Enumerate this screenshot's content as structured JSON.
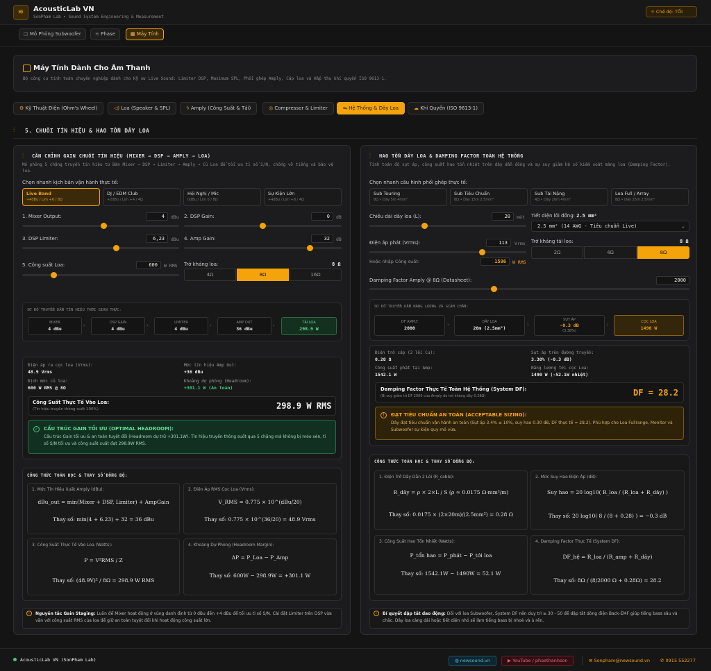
{
  "app": {
    "title": "AcousticLab VN",
    "subtitle": "SonPham Lab • Sound System Engineering & Measurement",
    "theme_label": "Chế độ: TỐI"
  },
  "nav": {
    "tabs": [
      {
        "label": "Mô Phỏng Subwoofer"
      },
      {
        "label": "Phase"
      },
      {
        "label": "Máy Tính"
      }
    ]
  },
  "hero": {
    "title": "Máy Tính Dành Cho Âm Thanh",
    "desc": "Bộ công cụ tính toán chuyên nghiệp dành cho Kỹ sư Live Sound: Limiter DSP, Maximum SPL, Phối ghép Amply, Cáp loa và Hấp thụ khí quyển ISO 9613-1."
  },
  "categories": [
    {
      "label": "Kỹ Thuật Điện (Ohm's Wheel)"
    },
    {
      "label": "Loa (Speaker & SPL)"
    },
    {
      "label": "Amply (Công Suất & Tải)"
    },
    {
      "label": "Compressor & Limiter"
    },
    {
      "label": "Hệ Thống & Dây Loa"
    },
    {
      "label": "Khí Quyển (ISO 9613-1)"
    }
  ],
  "section_title": "5. CHUỖI TÍN HIỆU & HAO TỔN DÂY LOA",
  "left": {
    "title": "CĂN CHỈNH GAIN CHUỖI TÍN HIỆU (MIXER → DSP → AMPLY → LOA)",
    "desc": "Mô phỏng 5 chặng truyền tín hiệu từ Bàn Mixer → DSP → Limiter → Amply → Củ Loa để tối ưu tỉ số S/N, chống vỡ tiếng và bảo vệ loa.",
    "preset_label": "Chọn nhanh kịch bản vận hành thực tế:",
    "presets": [
      {
        "t": "Live Band",
        "s": "+4dBu / Lim +6 / 8Ω"
      },
      {
        "t": "DJ / EDM Club",
        "s": "+2dBu / Lim +4 / 4Ω"
      },
      {
        "t": "Hội Nghị / Mic",
        "s": "0dBu / Lim 0 / 8Ω"
      },
      {
        "t": "Sự Kiện Lớn",
        "s": "+4dBu / Lim +8 / 4Ω"
      }
    ],
    "fields": {
      "mixer": {
        "label": "1. Mixer Output:",
        "value": "4",
        "unit": "dBu",
        "level": 0.52
      },
      "dsp": {
        "label": "2. DSP Gain:",
        "value": "0",
        "unit": "dB",
        "level": 0.5
      },
      "lim": {
        "label": "3. DSP Limiter:",
        "value": "6,23",
        "unit": "dBu",
        "level": 0.6
      },
      "amp": {
        "label": "4. Amp Gain:",
        "value": "32",
        "unit": "dB",
        "level": 0.8
      },
      "pow": {
        "label": "5. Công suất Loa:",
        "value": "600",
        "unit": "W RMS",
        "level": 0.2
      }
    },
    "imp": {
      "label": "Trở kháng loa:",
      "value": "8 Ω",
      "opts": [
        "4Ω",
        "8Ω",
        "16Ω"
      ]
    },
    "flow": {
      "title": "SƠ ĐỒ TRUYỀN DẪN TÍN HIỆU THỜI GIAN THỰC:",
      "nodes": [
        {
          "n": "MIXER",
          "v": "4 dBu"
        },
        {
          "n": "DSP GAIN",
          "v": "4 dBu"
        },
        {
          "n": "LIMITER",
          "v": "4 dBu"
        },
        {
          "n": "AMP OUT",
          "v": "36 dBu"
        },
        {
          "n": "TẢI LOA",
          "v": "298.9 W"
        }
      ]
    },
    "stats": [
      {
        "k": "Điện áp ra cọc loa (Vrms):",
        "v": "48.9 Vrms"
      },
      {
        "k": "Mức tín hiệu Amp Out:",
        "v": "+36 dBu"
      },
      {
        "k": "Định mức củ loa:",
        "v": "600 W RMS @ 8Ω"
      },
      {
        "k": "Khoảng dự phòng (Headroom):",
        "v": "+301.1 W (An toàn)"
      }
    ],
    "real": {
      "title": "Công Suất Thực Tế Vào Loa:",
      "sub": "(Tín hiệu truyền thông suốt 100%)",
      "value": "298.9 W RMS"
    },
    "ok": {
      "title": "CẤU TRÚC GAIN TỐI ƯU (OPTIMAL HEADROOM):",
      "text": "Cấu trúc Gain tối ưu & an toàn tuyệt đối (Headroom dự trữ +301.1W). Tín hiệu truyền thông suốt qua 5 chặng mà không bị méo xén, tỉ số S/N tối ưu và công suất xuất đạt 298.9W RMS."
    },
    "formula_title": "CÔNG THỨC TOÁN HỌC & THAY SỐ ĐỒNG BỘ:",
    "formulas": [
      {
        "h": "1. Mức Tín Hiệu Xuất Amply (dBu):",
        "f": "dBu_out = min(Mixer + DSP, Limiter) + AmpGain",
        "s": "Thay số: min(4 + 6.23) + 32 = 36 dBu"
      },
      {
        "h": "2. Điện Áp RMS Cọc Loa (Vrms):",
        "f": "V_RMS = 0.775 × 10^(dBu/20)",
        "s": "Thay số: 0.775 × 10^(36/20) = 48.9 Vrms"
      },
      {
        "h": "3. Công Suất Thực Tế Vào Loa (Watts):",
        "f": "P = V²RMS / Z",
        "s": "Thay số: (48.9V)² / 8Ω = 298.9 W RMS"
      },
      {
        "h": "4. Khoảng Dự Phòng (Headroom Margin):",
        "f": "ΔP = P_Loa − P_Amp",
        "s": "Thay số: 600W − 298.9W = +301.1 W"
      }
    ],
    "tip": {
      "title": "Nguyên tắc Gain Staging:",
      "text": "Luôn để Mixer hoạt động ở vùng danh định từ 0 dBu đến +4 dBu để tối ưu tỉ số S/N. Cài đặt Limiter trên DSP vừa vặn với công suất RMS của loa để giữ an toàn tuyệt đối khi hoạt động công suất lớn."
    }
  },
  "right": {
    "title": "HAO TỔN DÂY LOA & DAMPING FACTOR TOÀN HỆ THỐNG",
    "desc": "Tính toán độ sụt áp, công suất hao tổn nhiệt trên dây dẫn đồng và sự suy giảm hệ số kiểm soát màng loa (Damping Factor).",
    "preset_label": "Chọn nhanh cấu hình phối ghép thực tế:",
    "presets": [
      {
        "t": "Sub Touring",
        "s": "8Ω • Dây 5m 4mm²"
      },
      {
        "t": "Sub Tiêu Chuẩn",
        "s": "8Ω • Dây 15m 2.5mm²"
      },
      {
        "t": "Sub Tải Nặng",
        "s": "4Ω • Dây 20m 4mm²"
      },
      {
        "t": "Loa Full / Array",
        "s": "8Ω • Dây 25m 2.5mm²"
      }
    ],
    "len": {
      "label": "Chiều dài dây loa (L):",
      "value": "20",
      "unit": "mét",
      "level": 0.35
    },
    "sec": {
      "label": "Tiết diện lõi đồng:",
      "value": "2.5 mm²",
      "select": "2.5 mm² (14 AWG - Tiêu chuẩn Live)"
    },
    "volt": {
      "label": "Điện áp phát (Vrms):",
      "value": "113",
      "unit": "Vrms",
      "level": 0.72
    },
    "pw": {
      "label": "Hoặc nhập Công suất:",
      "value": "1596",
      "unit": "W RMS"
    },
    "imp": {
      "label": "Trở kháng tải loa:",
      "value": "8 Ω",
      "opts": [
        "2Ω",
        "4Ω",
        "8Ω"
      ]
    },
    "df": {
      "label": "Damping Factor Amply @ 8Ω (Datasheet):",
      "value": "2000",
      "level": 0.39
    },
    "flow": {
      "title": "SƠ ĐỒ TRUYỀN DẪN NĂNG LƯỢNG VÀ GIẢM CHẤN:",
      "nodes": [
        {
          "n": "DF AMPLY",
          "v": "2000"
        },
        {
          "n": "DÂY LOA",
          "v": "20m (2.5mm²)"
        },
        {
          "n": "SỤT ÁP",
          "v": "-0.3 dB",
          "x": "(3.38%)"
        },
        {
          "n": "CỌC LOA",
          "v": "1490 W"
        }
      ]
    },
    "stats": [
      {
        "k": "Điện trở cáp (2 lõi Cu):",
        "v": "0.28 Ω"
      },
      {
        "k": "Sụt áp trên đường truyền:",
        "v": "3.38% (-0.3 dB)"
      },
      {
        "k": "Công suất phát tại Amp:",
        "v": "1542.1 W"
      },
      {
        "k": "Năng lượng tới cọc Loa:",
        "v": "1490 W (-52.1W nhiệt)"
      }
    ],
    "dfbox": {
      "title": "Damping Factor Thực Tế Toàn Hệ Thống (System DF):",
      "sub": "(Bị suy giảm từ DF 2000 của Amply do trở kháng dây 0.28Ω)",
      "value": "DF = 28.2"
    },
    "warn": {
      "title": "ĐẠT TIÊU CHUẨN AN TOÀN (ACCEPTABLE SIZING):",
      "text": "Dây đạt tiêu chuẩn vận hành an toàn (Sụt áp 3.4% ≤ 10%, suy hao 0.30 dB, DF thực tế = 28.2). Phù hợp cho Loa Fullrange, Monitor và Subwoofer sự kiện quy mô vừa."
    },
    "formula_title": "CÔNG THỨC TOÁN HỌC & THAY SỐ ĐỒNG BỘ:",
    "formulas": [
      {
        "h": "1. Điện Trở Dây Dẫn 2 Lõi (R_cable):",
        "f": "R_dây = ρ × 2×L / S   (ρ ≈ 0.0175 Ω·mm²/m)",
        "s": "Thay số: 0.0175 × (2×20m)/(2.5mm²) = 0.28 Ω"
      },
      {
        "h": "2. Mức Suy Hao Điện Áp (dB):",
        "f": "Suy hao = 20 log10( R_loa / (R_loa + R_dây) )",
        "s": "Thay số: 20 log10( 8 / (8 + 0.28) ) = −0.3 dB"
      },
      {
        "h": "3. Công Suất Hao Tổn Nhiệt (Watts):",
        "f": "P_tổn hao = P_phát − P_tới loa",
        "s": "Thay số: 1542.1W − 1490W = 52.1 W"
      },
      {
        "h": "4. Damping Factor Thực Tế (System DF):",
        "f": "DF_hệ = R_loa / (R_amp + R_dây)",
        "s": "Thay số: 8Ω / (8/2000 Ω + 0.28Ω) = 28.2"
      }
    ],
    "tip": {
      "title": "Bí quyết dập tắt dao động:",
      "text": "Đối với loa Subwoofer, System DF nên duy trì ≥ 30 - 50 để dập tắt dòng điện Back-EMF giúp tiếng bass sâu và chắc. Dây loa càng dài hoặc tiết diện nhỏ sẽ làm tiếng bass bị nhoè và ù rền."
    }
  },
  "footer": {
    "brand": "AcousticLab VN (SonPham Lab)",
    "web": "newsound.vn",
    "yt": "YouTube / phaethanhson",
    "mail": "Sonpham@newsound.vn",
    "phone": "0915 552277"
  },
  "colors": {
    "accent": "#f5a30b",
    "ok": "#3ecf78",
    "bg": "#141414"
  }
}
